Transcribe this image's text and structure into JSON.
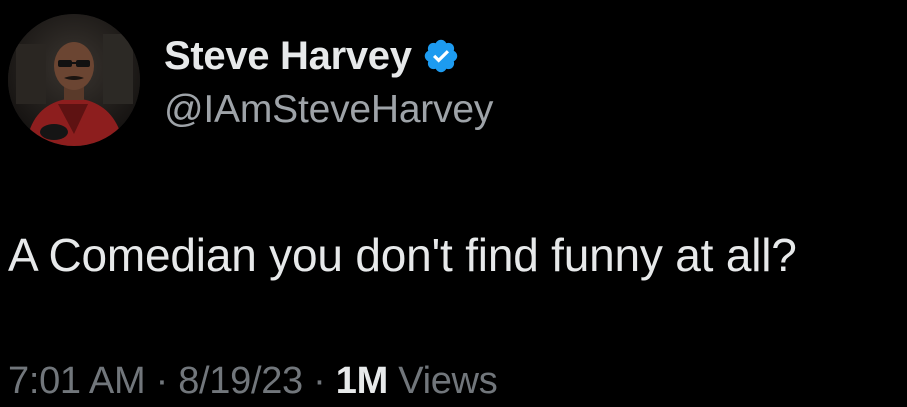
{
  "author": {
    "display_name": "Steve Harvey",
    "handle": "@IAmSteveHarvey",
    "verified": true,
    "avatar_icon": "profile-photo",
    "verified_icon": "verified-badge-icon"
  },
  "tweet": {
    "text": "A Comedian you don't find funny at all?"
  },
  "meta": {
    "time": "7:01 AM",
    "separator": " · ",
    "date": "8/19/23",
    "views_count": "1M",
    "views_label": " Views"
  },
  "colors": {
    "background": "#000000",
    "primary_text": "#e7e9ea",
    "secondary_text": "#71767b",
    "verified_blue": "#1d9bf0"
  }
}
